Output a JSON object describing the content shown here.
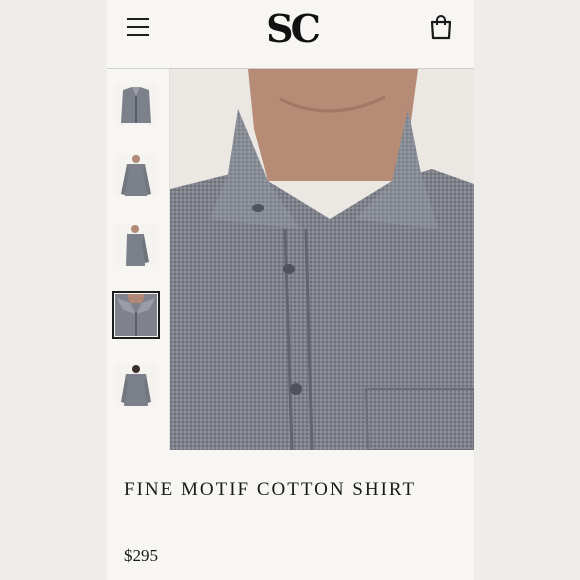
{
  "header": {
    "logo_text": "SC"
  },
  "product": {
    "title": "FINE MOTIF COTTON SHIRT",
    "price": "$295"
  },
  "gallery": {
    "thumbnail_count": 5,
    "selected_index": 3
  },
  "colors": {
    "background": "#f7f6f3",
    "text": "#1a1a1a",
    "shirt": "#7a7d86"
  },
  "icons": {
    "menu": "hamburger-icon",
    "cart": "shopping-bag-icon"
  }
}
